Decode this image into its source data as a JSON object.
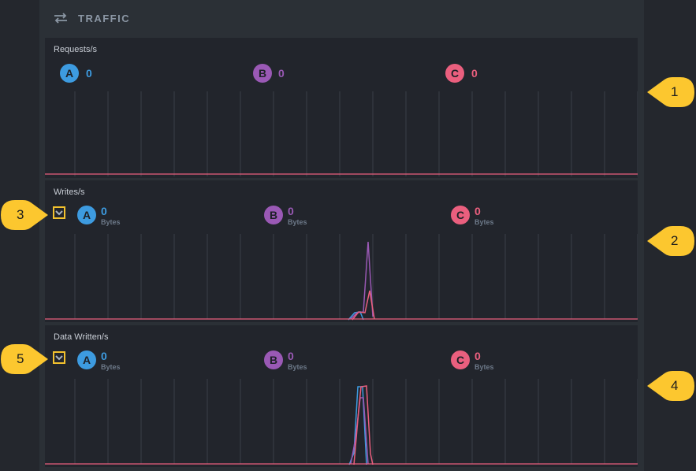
{
  "header": {
    "title": "TRAFFIC",
    "icon": "swap-arrows-icon"
  },
  "colors": {
    "a": "#3d9be0",
    "b": "#9a59b5",
    "c": "#ea5f7e",
    "baseline": "#ea5f7e",
    "grid": "#3a3f47",
    "callout": "#fcc72f"
  },
  "sections": [
    {
      "title": "Requests/s",
      "metrics": [
        {
          "key": "A",
          "value": "0",
          "unit": ""
        },
        {
          "key": "B",
          "value": "0",
          "unit": ""
        },
        {
          "key": "C",
          "value": "0",
          "unit": ""
        }
      ]
    },
    {
      "title": "Writes/s",
      "metrics": [
        {
          "key": "A",
          "value": "0",
          "unit": "Bytes"
        },
        {
          "key": "B",
          "value": "0",
          "unit": "Bytes"
        },
        {
          "key": "C",
          "value": "0",
          "unit": "Bytes"
        }
      ]
    },
    {
      "title": "Data Written/s",
      "metrics": [
        {
          "key": "A",
          "value": "0",
          "unit": "Bytes"
        },
        {
          "key": "B",
          "value": "0",
          "unit": "Bytes"
        },
        {
          "key": "C",
          "value": "0",
          "unit": "Bytes"
        }
      ]
    }
  ],
  "callouts": [
    "1",
    "2",
    "3",
    "4",
    "5"
  ]
}
